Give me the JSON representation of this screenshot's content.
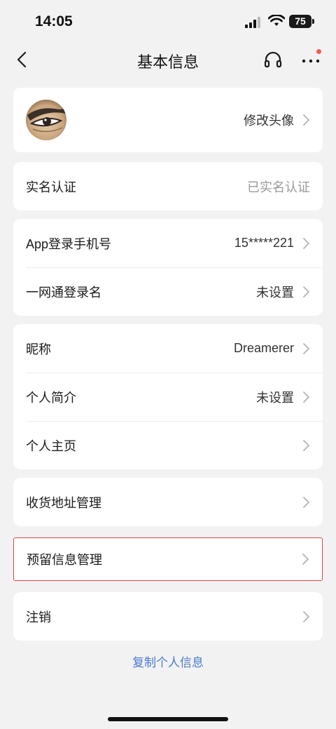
{
  "status": {
    "time": "14:05",
    "battery": "75"
  },
  "nav": {
    "title": "基本信息"
  },
  "profile": {
    "avatar_action": "修改头像"
  },
  "realname": {
    "label": "实名认证",
    "value": "已实名认证"
  },
  "login": {
    "phone_label": "App登录手机号",
    "phone_value": "15*****221",
    "account_label": "一网通登录名",
    "account_value": "未设置"
  },
  "personal": {
    "nickname_label": "昵称",
    "nickname_value": "Dreamerer",
    "bio_label": "个人简介",
    "bio_value": "未设置",
    "homepage_label": "个人主页"
  },
  "address": {
    "label": "收货地址管理"
  },
  "reserved": {
    "label": "预留信息管理"
  },
  "cancel": {
    "label": "注销"
  },
  "footer": {
    "copy_link": "复制个人信息"
  },
  "colors": {
    "highlight_border": "#e24444",
    "link": "#4b7bd1",
    "notification_dot": "#f25c54"
  }
}
